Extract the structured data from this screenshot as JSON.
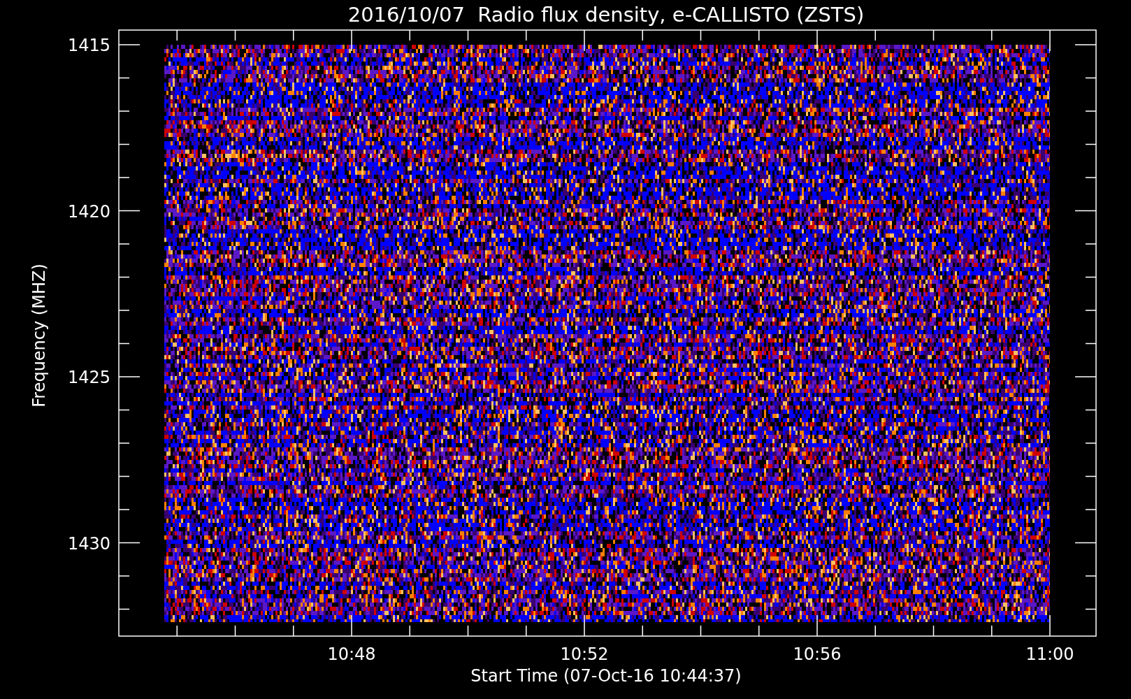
{
  "title": "2016/10/07  Radio flux density, e-CALLISTO (ZSTS)",
  "spectrogram": {
    "ylabel": "Frequency (MHZ)",
    "xlabel": "Start Time (07-Oct-16 10:44:37)",
    "y_tick_labels": [
      "1415",
      "1420",
      "1425",
      "1430"
    ],
    "x_tick_labels": [
      "10:48",
      "10:52",
      "10:56",
      "11:00"
    ]
  }
}
